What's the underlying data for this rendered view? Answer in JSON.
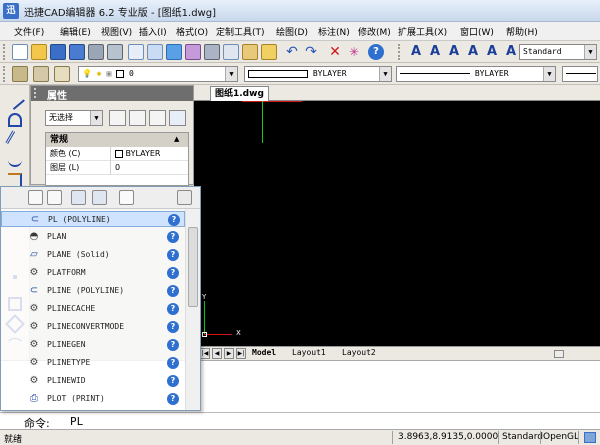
{
  "window": {
    "title": "迅捷CAD编辑器 6.2 专业版 - [图纸1.dwg]",
    "app_icon_text": "迅"
  },
  "menu": [
    "文件(F)",
    "编辑(E)",
    "视图(V)",
    "插入(I)",
    "格式(O)",
    "定制工具(T)",
    "绘图(D)",
    "标注(N)",
    "修改(M)",
    "扩展工具(X)",
    "窗口(W)",
    "帮助(H)"
  ],
  "toolbar": {
    "text_style": "Standard"
  },
  "layer_toolbar": {
    "layer_name": "0",
    "color": "BYLAYER",
    "linetype": "BYLAYER"
  },
  "properties": {
    "title": "属性",
    "selection": "无选择",
    "category": "常规",
    "rows": [
      {
        "name": "颜色 (C)",
        "value": "BYLAYER"
      },
      {
        "name": "图层 (L)",
        "value": "0"
      }
    ]
  },
  "drawing": {
    "tab_label": "图纸1.dwg",
    "axis_y": "Y",
    "axis_x": "X"
  },
  "layout_tabs": [
    "Model",
    "Layout1",
    "Layout2"
  ],
  "autocomplete": {
    "items": [
      {
        "label": "PL (POLYLINE)",
        "icon": "polyline-icon"
      },
      {
        "label": "PLAN",
        "icon": "plan-icon"
      },
      {
        "label": "PLANE (Solid)",
        "icon": "plane-icon"
      },
      {
        "label": "PLATFORM",
        "icon": "gear-icon"
      },
      {
        "label": "PLINE (POLYLINE)",
        "icon": "polyline-icon"
      },
      {
        "label": "PLINECACHE",
        "icon": "gear-icon"
      },
      {
        "label": "PLINECONVERTMODE",
        "icon": "gear-icon"
      },
      {
        "label": "PLINEGEN",
        "icon": "gear-icon"
      },
      {
        "label": "PLINETYPE",
        "icon": "gear-icon"
      },
      {
        "label": "PLINEWID",
        "icon": "gear-icon"
      },
      {
        "label": "PLOT (PRINT)",
        "icon": "printer-icon"
      }
    ],
    "help_glyph": "?"
  },
  "command": {
    "prompt": "命令:",
    "text": "PL"
  },
  "status": {
    "ready": "就绪",
    "coords": "3.8963,8.9135,0.0000",
    "style": "Standard",
    "renderer": "OpenGL"
  },
  "colors": {
    "canvas": "#000000",
    "crosshair_red": "#d01818",
    "crosshair_green": "#18c818",
    "selection": "#cfe3ff",
    "help_blue": "#2f6fd0"
  }
}
